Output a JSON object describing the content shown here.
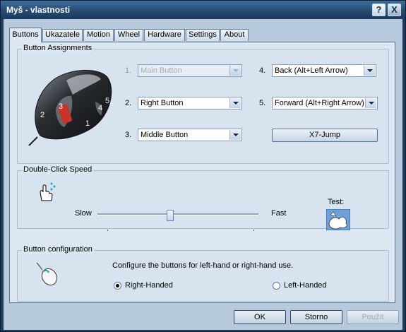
{
  "window": {
    "title": "Myš - vlastnosti",
    "help_glyph": "?",
    "close_glyph": "X"
  },
  "tabs": [
    {
      "label": "Buttons",
      "active": true
    },
    {
      "label": "Ukazatele"
    },
    {
      "label": "Motion"
    },
    {
      "label": "Wheel"
    },
    {
      "label": "Hardware"
    },
    {
      "label": "Settings"
    },
    {
      "label": "About"
    }
  ],
  "button_assignments": {
    "title": "Button Assignments",
    "mouse_labels": [
      "1",
      "2",
      "3",
      "4",
      "5"
    ],
    "slots": [
      {
        "number": "1.",
        "value": "Main Button",
        "disabled": true
      },
      {
        "number": "2.",
        "value": "Right Button"
      },
      {
        "number": "3.",
        "value": "Middle Button"
      },
      {
        "number": "4.",
        "value": "Back (Alt+Left Arrow)"
      },
      {
        "number": "5.",
        "value": "Forward (Alt+Right Arrow)"
      }
    ],
    "x7_jump_label": "X7-Jump"
  },
  "double_click": {
    "title": "Double-Click Speed",
    "slow_label": "Slow",
    "fast_label": "Fast",
    "test_label": "Test:",
    "speed_fraction": 0.45
  },
  "button_config": {
    "title": "Button configuration",
    "description": "Configure the buttons for left-hand or right-hand use.",
    "right_label": "Right-Handed",
    "left_label": "Left-Handed",
    "selected": "right"
  },
  "footer": {
    "ok": "OK",
    "cancel": "Storno",
    "apply": "Použít"
  }
}
